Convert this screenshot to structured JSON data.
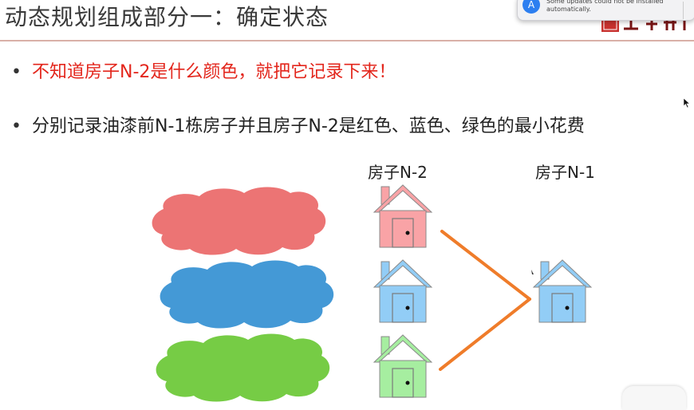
{
  "slide": {
    "title": "动态规划组成部分一：确定状态",
    "bullets": [
      {
        "text": "不知道房子N-2是什么颜色，就把它记录下来！",
        "color": "#e3261c"
      },
      {
        "text": "分别记录油漆前N-1栋房子并且房子N-2是红色、蓝色、绿色的最小花费",
        "color": "#222222"
      }
    ],
    "bullet_glyph": "•",
    "captions": {
      "house_n2": "房子N-2",
      "house_n1": "房子N-1"
    },
    "colors": {
      "red_cloud": "#ec7474",
      "blue_cloud": "#4499d6",
      "green_cloud": "#76cc45",
      "red_house": "#f9a3a6",
      "blue_house": "#92cdf6",
      "green_house": "#a6eea0",
      "connector": "#ef7c2a"
    }
  },
  "notification": {
    "text": "Some updates could not be installed automatically.",
    "icon": "app-store-icon"
  },
  "overlay": {
    "logo_icon": "brand-seal-logo",
    "cursor_icon": "mouse-pointer-icon"
  }
}
